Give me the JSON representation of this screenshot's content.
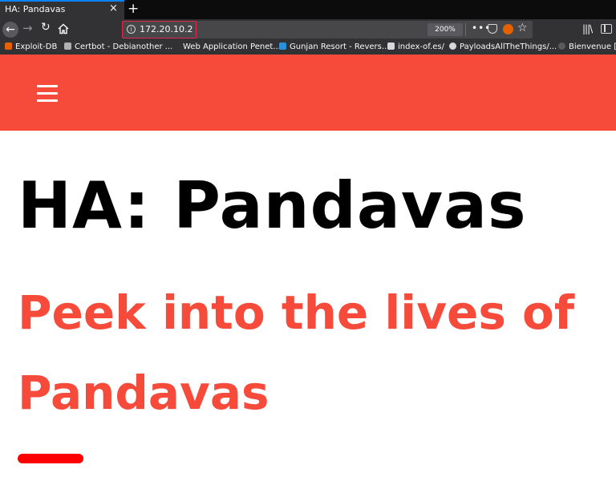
{
  "browser": {
    "tab": {
      "title": "HA: Pandavas",
      "close_glyph": "×"
    },
    "new_tab_glyph": "+",
    "url": "172.20.10.2",
    "zoom": "200%",
    "page_actions_glyph": "•••",
    "star_glyph": "☆",
    "library_glyph": "|||\\",
    "bookmarks": [
      {
        "label": "Exploit-DB",
        "icon_color": "#e66000"
      },
      {
        "label": "Certbot - Debianother ...",
        "icon_color": "#b0b0b0"
      },
      {
        "label": "Web Application Penet...",
        "icon_color": "#323234"
      },
      {
        "label": "Gunjan Resort - Revers...",
        "icon_color": "#2a90d8"
      },
      {
        "label": "index-of.es/",
        "icon_color": "#d7d7db"
      },
      {
        "label": "PayloadsAllTheThings/...",
        "icon_color": "#d7d7db"
      },
      {
        "label": "Bienvenue [R",
        "icon_color": "#5a5a5e"
      }
    ]
  },
  "page": {
    "title": "HA: Pandavas",
    "subtitle": "Peek into the lives of Pandavas",
    "header_color": "#f64a3b",
    "accent_color": "#ff0000"
  }
}
